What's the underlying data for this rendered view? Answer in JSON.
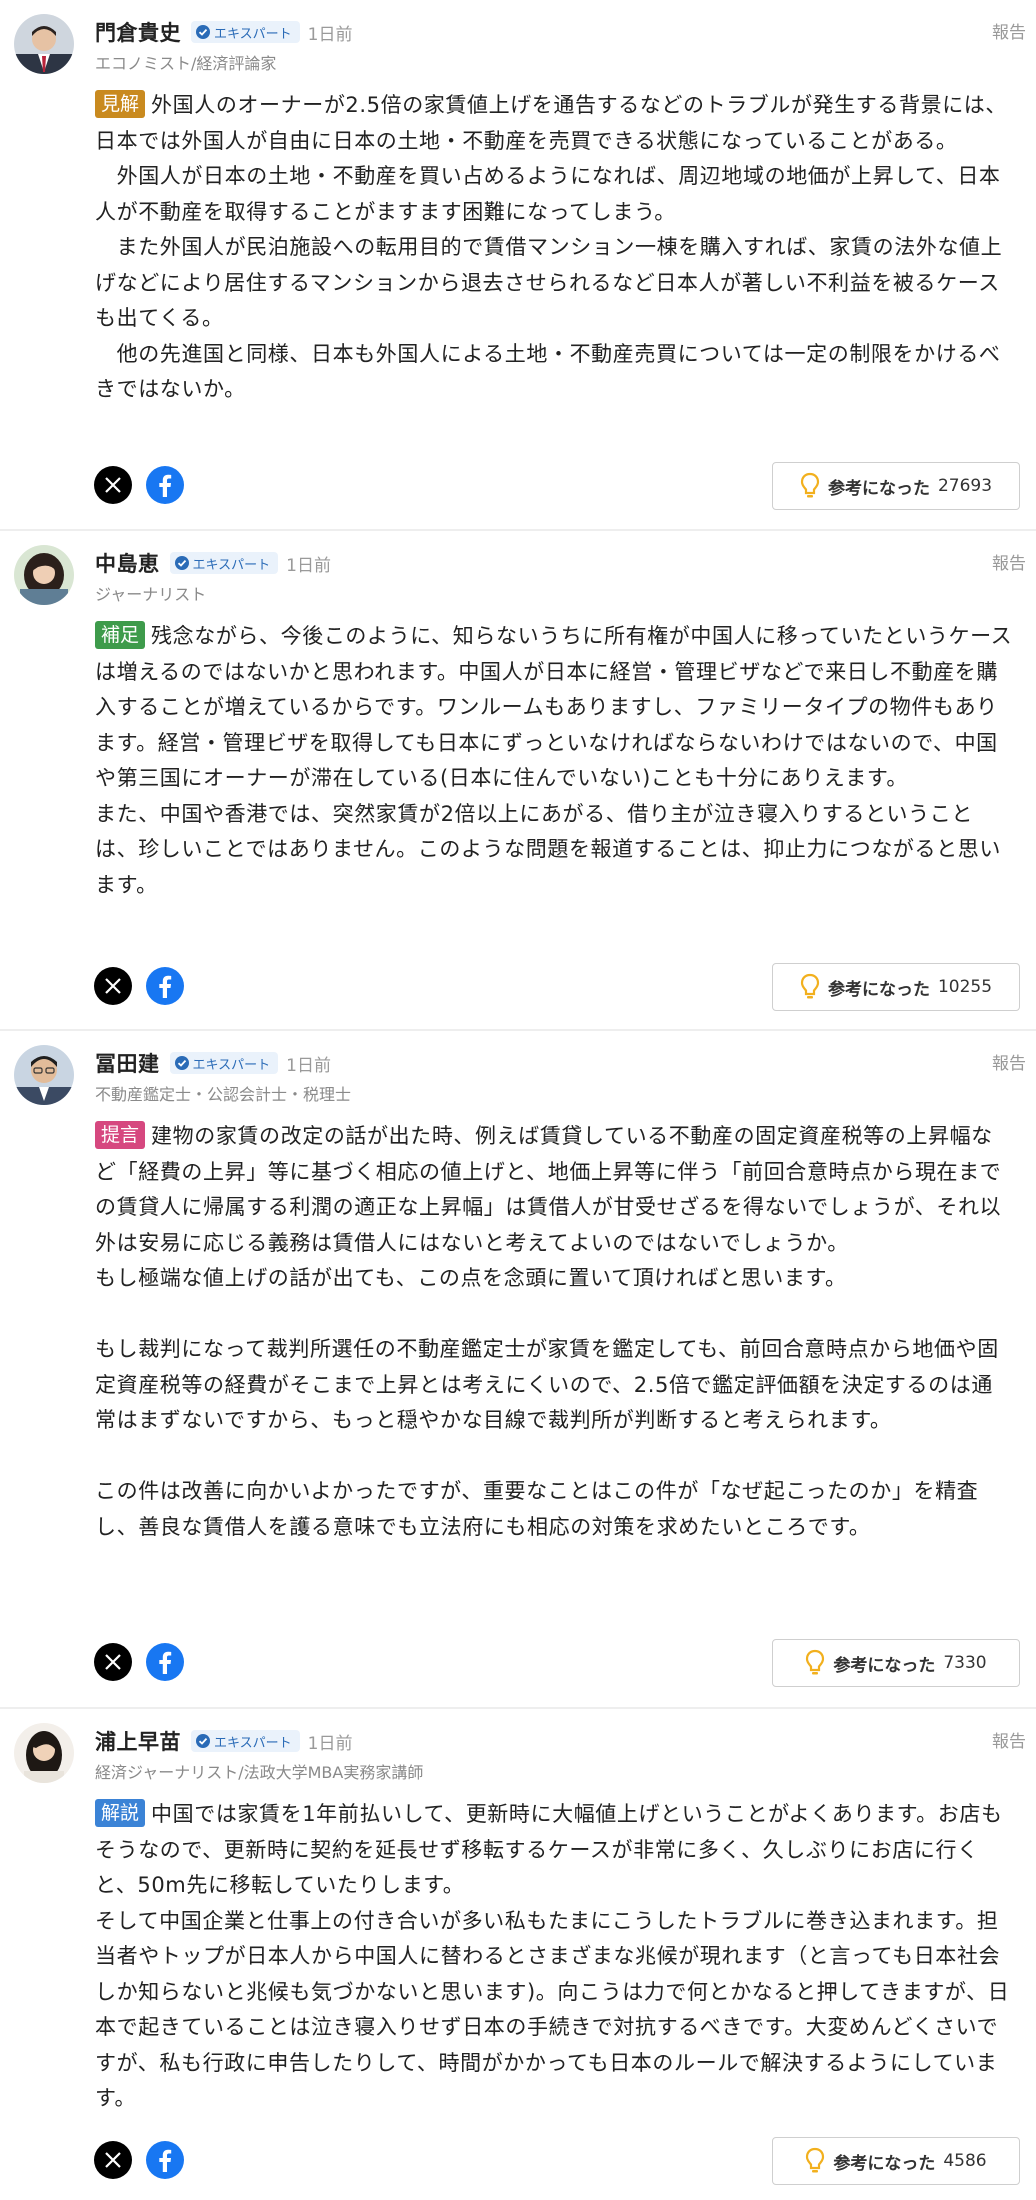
{
  "common": {
    "report_label": "報告",
    "helpful_label": "参考になった",
    "expert_badge": "エキスパート"
  },
  "colors": {
    "tag_kenkai": "#c98a1f",
    "tag_hosoku": "#3e9b4b",
    "tag_teigen": "#d6487f",
    "tag_kaisetsu": "#3b83d6",
    "facebook": "#1877f2",
    "bulb": "#f2b01e"
  },
  "comments": [
    {
      "name": "門倉貴史",
      "time": "1日前",
      "role": "エコノミスト/経済評論家",
      "tag": "見解",
      "text": "外国人のオーナーが2.5倍の家賃値上げを通告するなどのトラブルが発生する背景には、日本では外国人が自由に日本の土地・不動産を売買できる状態になっていることがある。\n　外国人が日本の土地・不動産を買い占めるようになれば、周辺地域の地価が上昇して、日本人が不動産を取得することがますます困難になってしまう。\n　また外国人が民泊施設への転用目的で賃借マンション一棟を購入すれば、家賃の法外な値上げなどにより居住するマンションから退去させられるなど日本人が著しい不利益を被るケースも出てくる。\n　他の先進国と同様、日本も外国人による土地・不動産売買については一定の制限をかけるべきではないか。",
      "helpful_count": "27693"
    },
    {
      "name": "中島恵",
      "time": "1日前",
      "role": "ジャーナリスト",
      "tag": "補足",
      "text": "残念ながら、今後このように、知らないうちに所有権が中国人に移っていたというケースは増えるのではないかと思われます。中国人が日本に経営・管理ビザなどで来日し不動産を購入することが増えているからです。ワンルームもありますし、ファミリータイプの物件もあります。経営・管理ビザを取得しても日本にずっといなければならないわけではないので、中国や第三国にオーナーが滞在している(日本に住んでいない)ことも十分にありえます。\nまた、中国や香港では、突然家賃が2倍以上にあがる、借り主が泣き寝入りするということは、珍しいことではありません。このような問題を報道することは、抑止力につながると思います。",
      "helpful_count": "10255"
    },
    {
      "name": "冨田建",
      "time": "1日前",
      "role": "不動産鑑定士・公認会計士・税理士",
      "tag": "提言",
      "text": "建物の家賃の改定の話が出た時、例えば賃貸している不動産の固定資産税等の上昇幅など「経費の上昇」等に基づく相応の値上げと、地価上昇等に伴う「前回合意時点から現在までの賃貸人に帰属する利潤の適正な上昇幅」は賃借人が甘受せざるを得ないでしょうが、それ以外は安易に応じる義務は賃借人にはないと考えてよいのではないでしょうか。\nもし極端な値上げの話が出ても、この点を念頭に置いて頂ければと思います。\n\nもし裁判になって裁判所選任の不動産鑑定士が家賃を鑑定しても、前回合意時点から地価や固定資産税等の経費がそこまで上昇とは考えにくいので、2.5倍で鑑定評価額を決定するのは通常はまずないですから、もっと穏やかな目線で裁判所が判断すると考えられます。\n\nこの件は改善に向かいよかったですが、重要なことはこの件が「なぜ起こったのか」を精査し、善良な賃借人を護る意味でも立法府にも相応の対策を求めたいところです。",
      "helpful_count": "7330"
    },
    {
      "name": "浦上早苗",
      "time": "1日前",
      "role": "経済ジャーナリスト/法政大学MBA実務家講師",
      "tag": "解説",
      "text": "中国では家賃を1年前払いして、更新時に大幅値上げということがよくあります。お店もそうなので、更新時に契約を延長せず移転するケースが非常に多く、久しぶりにお店に行くと、50m先に移転していたりします。\nそして中国企業と仕事上の付き合いが多い私もたまにこうしたトラブルに巻き込まれます。担当者やトップが日本人から中国人に替わるとさまざまな兆候が現れます（と言っても日本社会しか知らないと兆候も気づかないと思います)。向こうは力で何とかなると押してきますが、日本で起きていることは泣き寝入りせず日本の手続きで対抗するべきです。大変めんどくさいですが、私も行政に申告したりして、時間がかかっても日本のルールで解決するようにしています。",
      "helpful_count": "4586"
    }
  ]
}
